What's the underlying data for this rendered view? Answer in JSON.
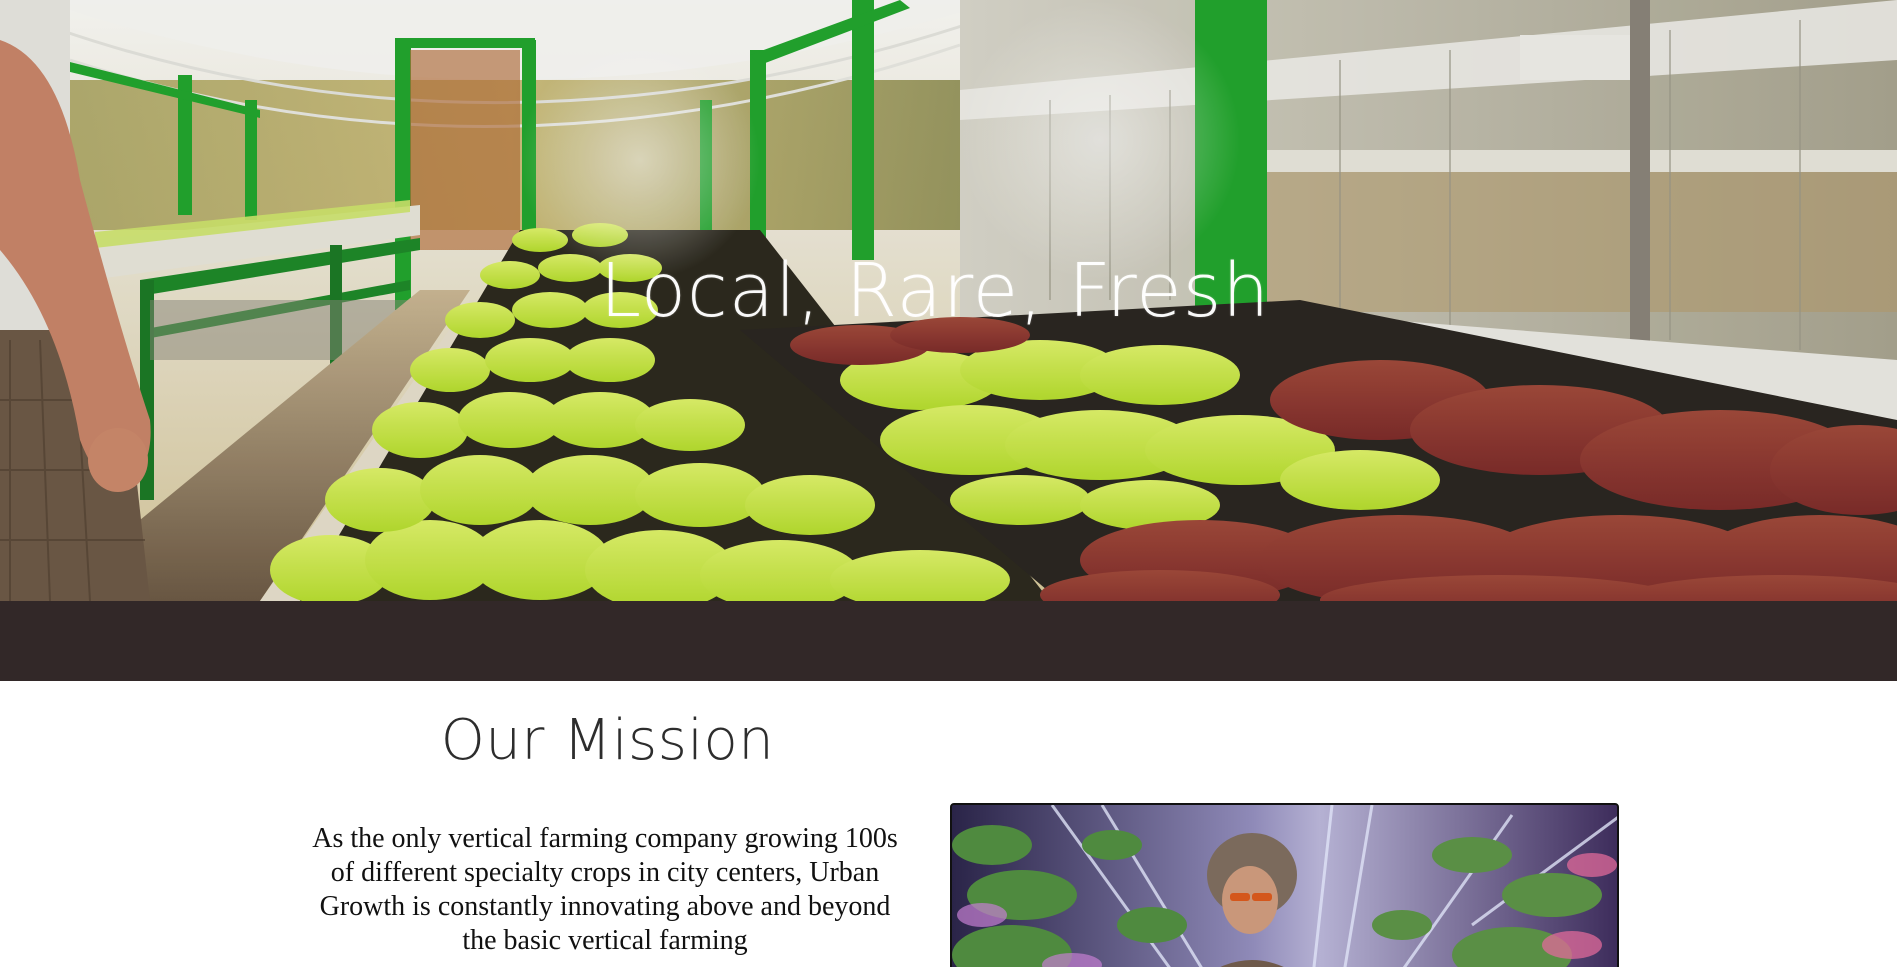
{
  "hero": {
    "title": "Local, Rare, Fresh"
  },
  "mission": {
    "heading": "Our Mission",
    "body": "As the only vertical farming company growing 100s of different specialty crops in city centers, Urban Growth is constantly innovating above and beyond the basic vertical farming"
  },
  "colors": {
    "dark_band": "#322828",
    "hero_green_frame": "#23a62e"
  }
}
